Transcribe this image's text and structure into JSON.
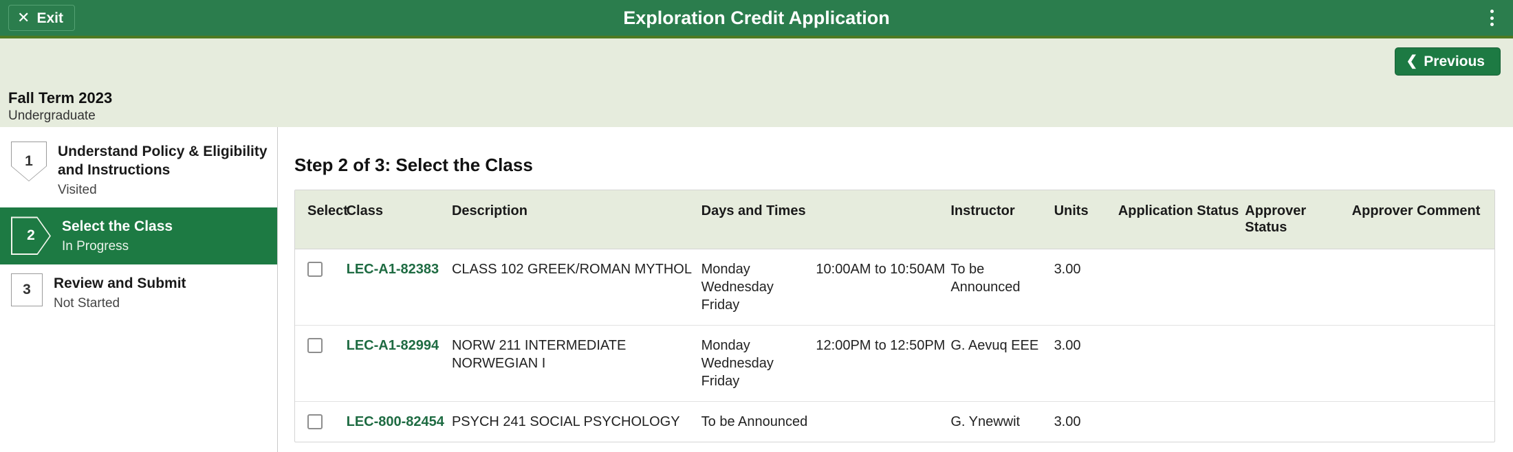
{
  "topbar": {
    "exit_label": "Exit",
    "exit_icon": "close-x-icon",
    "title": "Exploration Credit Application",
    "menu_icon": "kebab-vertical-icon",
    "bg_color": "#2b7d4d",
    "accent_color": "#4e7a22"
  },
  "action_band": {
    "previous_label": "Previous",
    "previous_icon": "chevron-double-left-icon"
  },
  "term": {
    "title": "Fall Term 2023",
    "career": "Undergraduate"
  },
  "sidebar": {
    "steps": [
      {
        "number": "1",
        "title": "Understand Policy & Eligibility and Instructions",
        "status": "Visited",
        "shape": "down"
      },
      {
        "number": "2",
        "title": "Select the Class",
        "status": "In Progress",
        "shape": "right"
      },
      {
        "number": "3",
        "title": "Review and Submit",
        "status": "Not Started",
        "shape": "square"
      }
    ]
  },
  "content": {
    "heading": "Step 2 of 3: Select the Class",
    "table": {
      "columns": [
        "Select",
        "Class",
        "Description",
        "Days and Times",
        "Instructor",
        "Units",
        "Application Status",
        "Approver Status",
        "Approver Comment"
      ],
      "rows": [
        {
          "selected": false,
          "class": "LEC-A1-82383",
          "description": "CLASS 102  GREEK/ROMAN MYTHOL",
          "days": "Monday Wednesday Friday",
          "times": "10:00AM to 10:50AM",
          "instructor": "To be Announced",
          "units": "3.00",
          "application_status": "",
          "approver_status": "",
          "approver_comment": ""
        },
        {
          "selected": false,
          "class": "LEC-A1-82994",
          "description": "NORW 211  INTERMEDIATE NORWEGIAN I",
          "days": "Monday Wednesday Friday",
          "times": "12:00PM to 12:50PM",
          "instructor": "G. Aevuq EEE",
          "units": "3.00",
          "application_status": "",
          "approver_status": "",
          "approver_comment": ""
        },
        {
          "selected": false,
          "class": "LEC-800-82454",
          "description": "PSYCH 241  SOCIAL PSYCHOLOGY",
          "days": "To be Announced",
          "times": "",
          "instructor": "G. Ynewwit",
          "units": "3.00",
          "application_status": "",
          "approver_status": "",
          "approver_comment": ""
        }
      ]
    }
  }
}
